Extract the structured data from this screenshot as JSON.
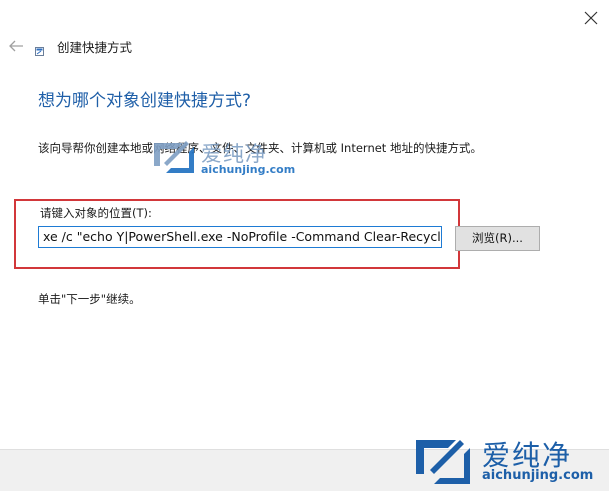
{
  "window": {
    "title": "创建快捷方式"
  },
  "wizard": {
    "heading": "想为哪个对象创建快捷方式?",
    "description": "该向导帮你创建本地或网络程序、文件、文件夹、计算机或 Internet 地址的快捷方式。",
    "location_label": "请键入对象的位置(T):",
    "location_value": "xe /c \"echo Y|PowerShell.exe -NoProfile -Command Clear-RecycleBin",
    "browse_label": "浏览(R)...",
    "hint": "单击\"下一步\"继续。"
  },
  "watermark": {
    "name": "爱纯净",
    "url": "aichunjing.com"
  },
  "colors": {
    "accent": "#1f5fa8",
    "highlight": "#d2373a",
    "input_border": "#1e7bd4"
  },
  "icons": {
    "close": "close-icon",
    "back": "back-arrow-icon",
    "wizard": "shortcut-wizard-icon"
  }
}
